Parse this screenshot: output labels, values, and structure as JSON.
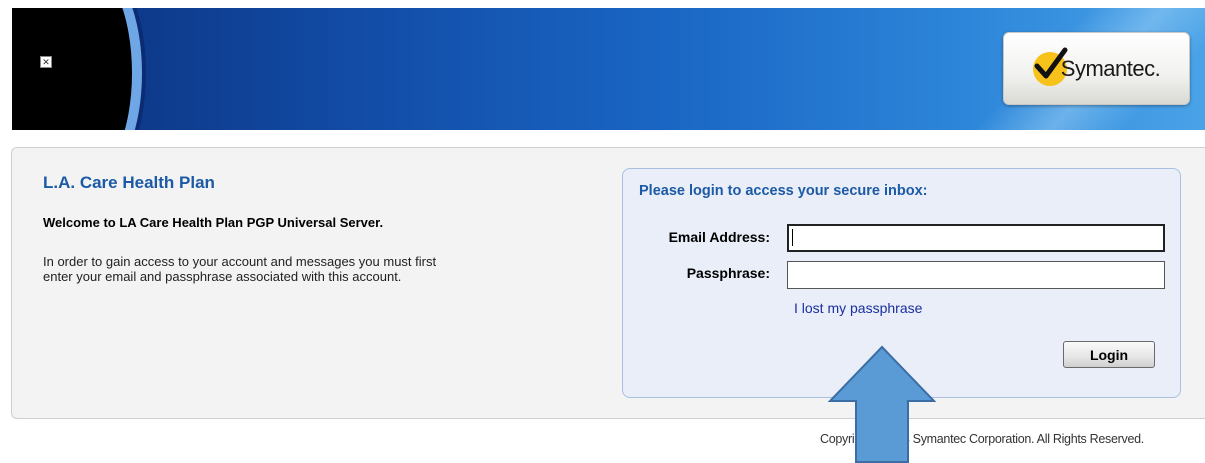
{
  "header": {
    "logo_text": "Symantec.",
    "broken_image_glyph": "✕"
  },
  "main": {
    "org_title": "L.A. Care Health Plan",
    "welcome": "Welcome to LA Care Health Plan PGP Universal Server.",
    "instructions_line1": "In order to gain access to your account and messages you must first",
    "instructions_line2": "enter your email and passphrase associated with this account."
  },
  "login": {
    "heading": "Please login to access your secure inbox:",
    "email_label": "Email Address:",
    "email_value": "",
    "passphrase_label": "Passphrase:",
    "passphrase_value": "",
    "lost_link": "I lost my passphrase",
    "login_button": "Login"
  },
  "footer": {
    "copyright": "Copyright ©2013 Symantec Corporation. All Rights Reserved."
  },
  "colors": {
    "title_blue": "#1c5aa6",
    "link_blue": "#1a2fa0",
    "arrow_fill": "#5b9bd5",
    "arrow_stroke": "#3a6ea5",
    "logo_check": "#f7c21a"
  }
}
